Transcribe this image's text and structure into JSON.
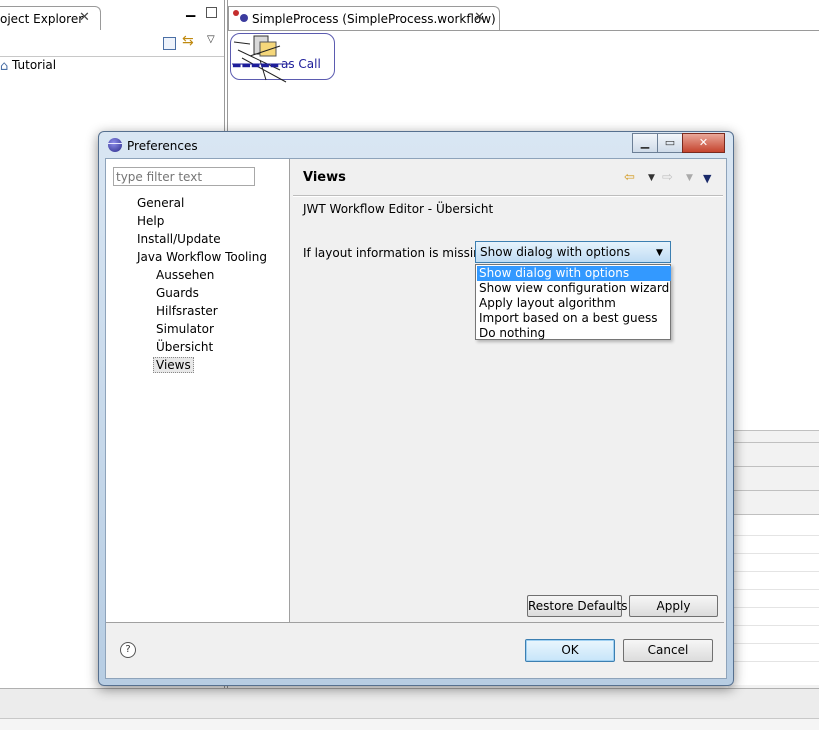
{
  "workbench": {
    "explorer_tab": "oject Explorer",
    "explorer_item": "Tutorial",
    "editor_tab": "SimpleProcess (SimpleProcess.workflow)",
    "canvas_node": "as Call"
  },
  "dialog": {
    "title": "Preferences",
    "filter_placeholder": "type filter text",
    "tree": [
      "General",
      "Help",
      "Install/Update",
      "Java Workflow Tooling",
      "Aussehen",
      "Guards",
      "Hilfsraster",
      "Simulator",
      "Übersicht",
      "Views"
    ],
    "page_title": "Views",
    "page_subtitle": "JWT Workflow Editor - Übersicht",
    "field_label": "If layout information is missing",
    "combo_value": "Show dialog with options",
    "options": [
      "Show dialog with options",
      "Show view configuration wizard",
      "Apply layout algorithm",
      "Import based on a best guess",
      "Do nothing"
    ],
    "restore_defaults": "Restore Defaults",
    "apply": "Apply",
    "ok": "OK",
    "cancel": "Cancel"
  },
  "colors": {
    "accent": "#3399ff",
    "title_bar": "#b7cde3"
  },
  "icons": [
    "close-icon",
    "minimize-icon",
    "maximize-icon",
    "collapse-all-icon",
    "link-editor-icon",
    "view-menu-icon",
    "project-icon",
    "workflow-file-icon",
    "back-icon",
    "forward-icon",
    "help-icon",
    "eclipse-icon"
  ]
}
